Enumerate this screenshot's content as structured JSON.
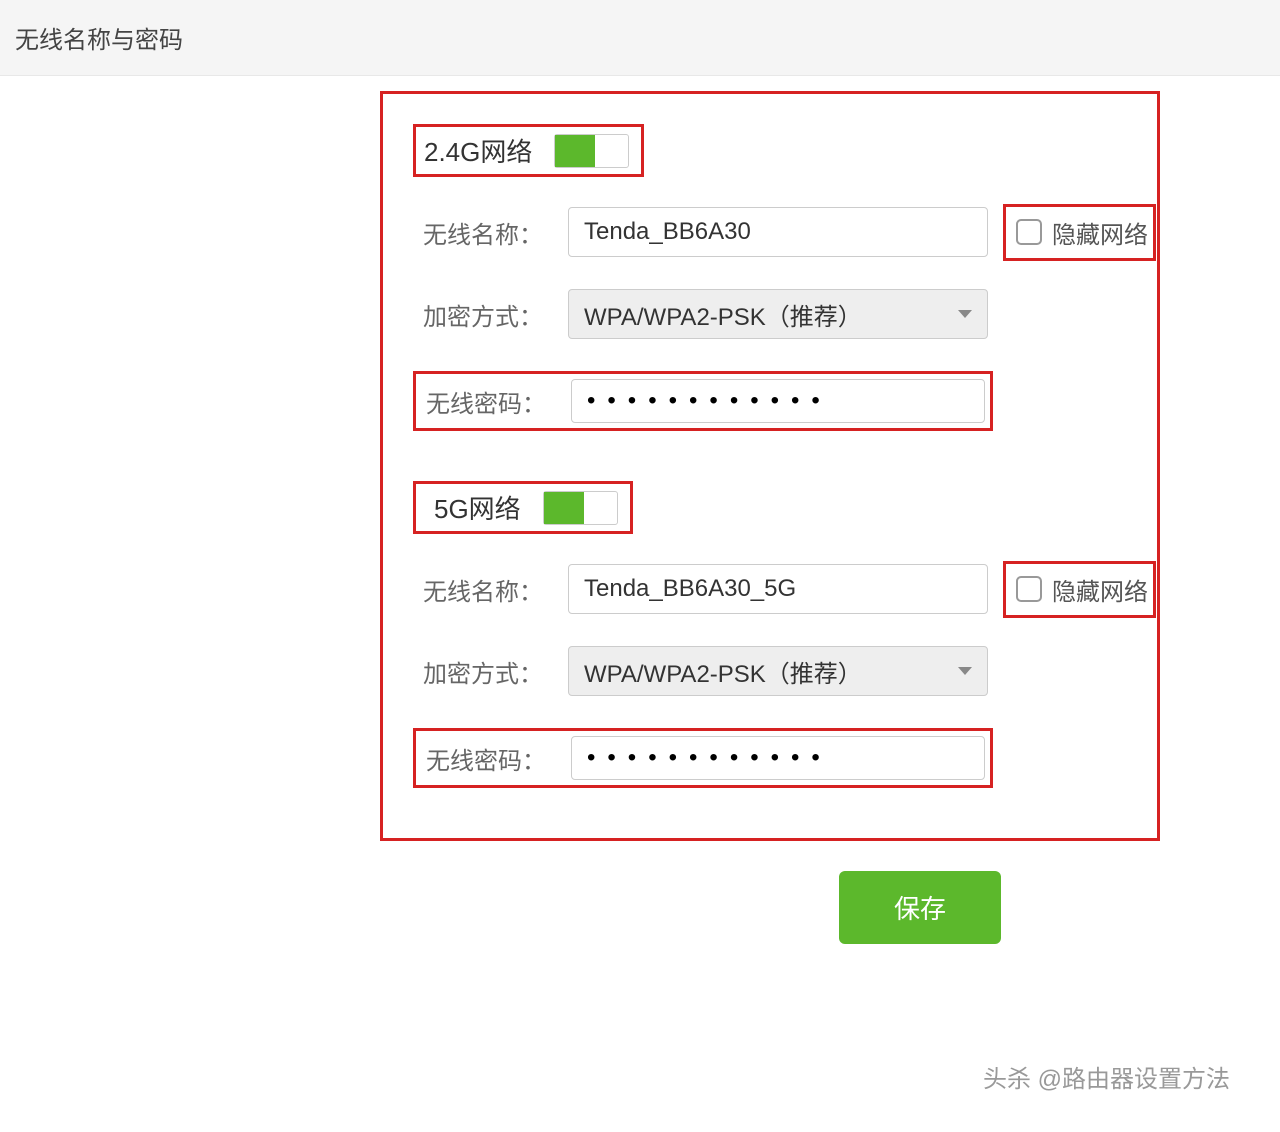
{
  "header": {
    "title": "无线名称与密码"
  },
  "network24": {
    "title": "2.4G网络",
    "toggle_on": true,
    "ssid_label": "无线名称：",
    "ssid_value": "Tenda_BB6A30",
    "hide_label": "隐藏网络",
    "encryption_label": "加密方式：",
    "encryption_value": "WPA/WPA2-PSK（推荐）",
    "password_label": "无线密码：",
    "password_value": "••••••••••••"
  },
  "network5": {
    "title": "5G网络",
    "toggle_on": true,
    "ssid_label": "无线名称：",
    "ssid_value": "Tenda_BB6A30_5G",
    "hide_label": "隐藏网络",
    "encryption_label": "加密方式：",
    "encryption_value": "WPA/WPA2-PSK（推荐）",
    "password_label": "无线密码：",
    "password_value": "••••••••••••"
  },
  "footer": {
    "save_label": "保存"
  },
  "watermark": "头杀 @路由器设置方法",
  "colors": {
    "accent_green": "#5cb82c",
    "highlight_red": "#d62222"
  }
}
